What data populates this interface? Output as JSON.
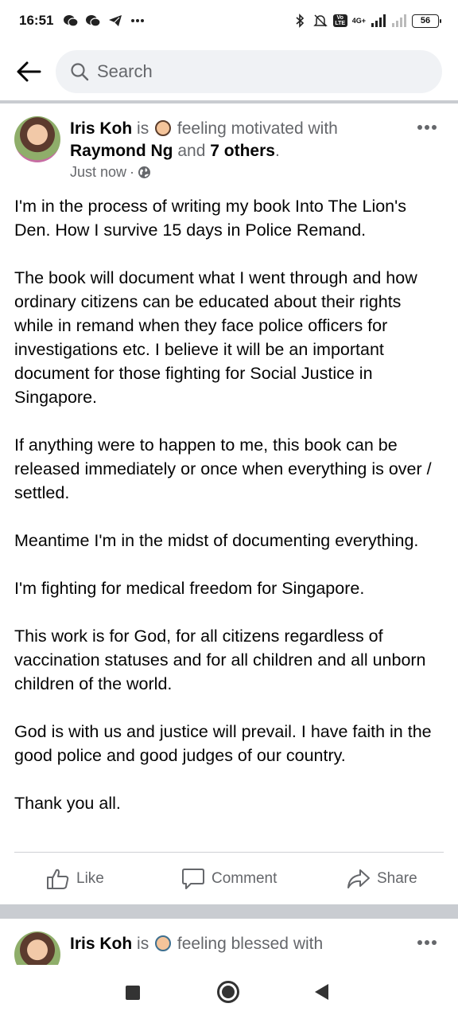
{
  "status_bar": {
    "time": "16:51",
    "network": "4G+",
    "battery": "56",
    "volte": "Vo LTE"
  },
  "header": {
    "search_placeholder": "Search"
  },
  "post": {
    "author": "Iris Koh",
    "verb": "is",
    "feeling": "feeling motivated with",
    "tagged": "Raymond Ng",
    "and": "and",
    "others": "7 others",
    "period": ".",
    "time": "Just now",
    "separator": "·",
    "paragraphs": [
      "I'm in the process of writing my book Into The Lion's Den. How I survive 15 days in Police Remand.",
      "The book will document what I went through and how ordinary citizens can be educated about their rights while in remand when they face police officers for investigations etc. I believe it will be an important document for those fighting for Social Justice in Singapore.",
      "If anything were to happen to me, this book can be released immediately or once when everything is over / settled.",
      "Meantime I'm in the midst of documenting everything.",
      "I'm fighting for medical freedom for Singapore.",
      "This work is for God, for all citizens regardless of vaccination statuses and for all children and all unborn children of the world.",
      "God is with us and justice will prevail. I have faith in the good police and good judges of our country.",
      "Thank you all."
    ],
    "actions": {
      "like": "Like",
      "comment": "Comment",
      "share": "Share"
    }
  },
  "post2": {
    "author": "Iris Koh",
    "verb": "is",
    "feeling": "feeling blessed with"
  }
}
